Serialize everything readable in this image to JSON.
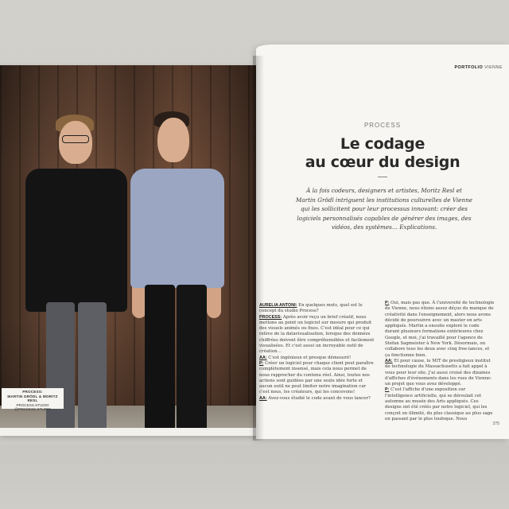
{
  "caption": {
    "line1": "PROCESS:",
    "line2": "MARTIN GRÖDL & MORITZ RESL",
    "line3": "PROCESS.STUDIO",
    "line4": "@PROCESS.STUDIO"
  },
  "article": {
    "running_head_section": "PORTFOLIO",
    "running_head_city": "VIENNE",
    "kicker": "PROCESS",
    "headline_line1": "Le codage",
    "headline_line2": "au cœur du design",
    "lede": "À la fois codeurs, designers et artistes, Moritz Resl et Martin Grödl intriguent les institutions culturelles de Vienne qui les sollicitent pour leur processus innovant: créer des logiciels personnalisés capables de générer des images, des vidéos, des systèmes… Explications.",
    "page_number": "275",
    "left_column": [
      {
        "label": "AURELIA ANTONI:",
        "text": " En quelques mots, quel est le concept du studio Process?"
      },
      {
        "label": "PROCESS:",
        "text": " Après avoir reçu un brief créatif, nous mettons au point un logiciel sur mesure qui produit des visuels animés ou fixes. C'est idéal pour ce qui relève de la datavisualisation, lorsque des données chiffrées doivent être compréhensibles et facilement visualisées. Et c'est aussi un incroyable outil de création…"
      },
      {
        "label": "AA:",
        "text": " C'est ingénieux et presque démesuré!"
      },
      {
        "label": "P:",
        "text": " Créer un logiciel pour chaque client peut paraître complètement insensé, mais cela nous permet de nous rapprocher du contenu réel. Ainsi, toutes nos actions sont guidées par une seule idée forte et aucun outil ne peut limiter notre imagination car c'est nous, les créateurs, qui les concevons!"
      },
      {
        "label": "AA:",
        "text": " Avez-vous étudié le code avant de vous lancer?"
      }
    ],
    "right_column": [
      {
        "label": "P:",
        "text": " Oui, mais pas que. À l'université de technologie de Vienne, nous étions assez déçus du manque de créativité dans l'enseignement, alors nous avons décidé de poursuivre avec un master en arts appliqués. Martin a ensuite exploré le code durant plusieurs formations extérieures chez Google, et moi, j'ai travaillé pour l'agence de Stefan Sagmeister à New York. Désormais, on collabore tous les deux avec cinq free-lances, et ça fonctionne bien."
      },
      {
        "label": "AA:",
        "text": " Et pour cause, le MIT de prestigieux institut de technologie du Massachusetts a fait appel à vous pour leur site. J'ai aussi croisé des dizaines d'affiches d'événements dans les rues de Vienne: un projet que vous avez développé."
      },
      {
        "label": "P:",
        "text": " C'est l'affiche d'une exposition sur l'intelligence artificielle, qui se déroulait cet automne au musée des Arts appliqués. Ces designs ont été créés par notre logiciel, qui les conçoit en illimité, du plus classique au plus sage en passant par le plus loufoque. Nous"
      }
    ]
  }
}
